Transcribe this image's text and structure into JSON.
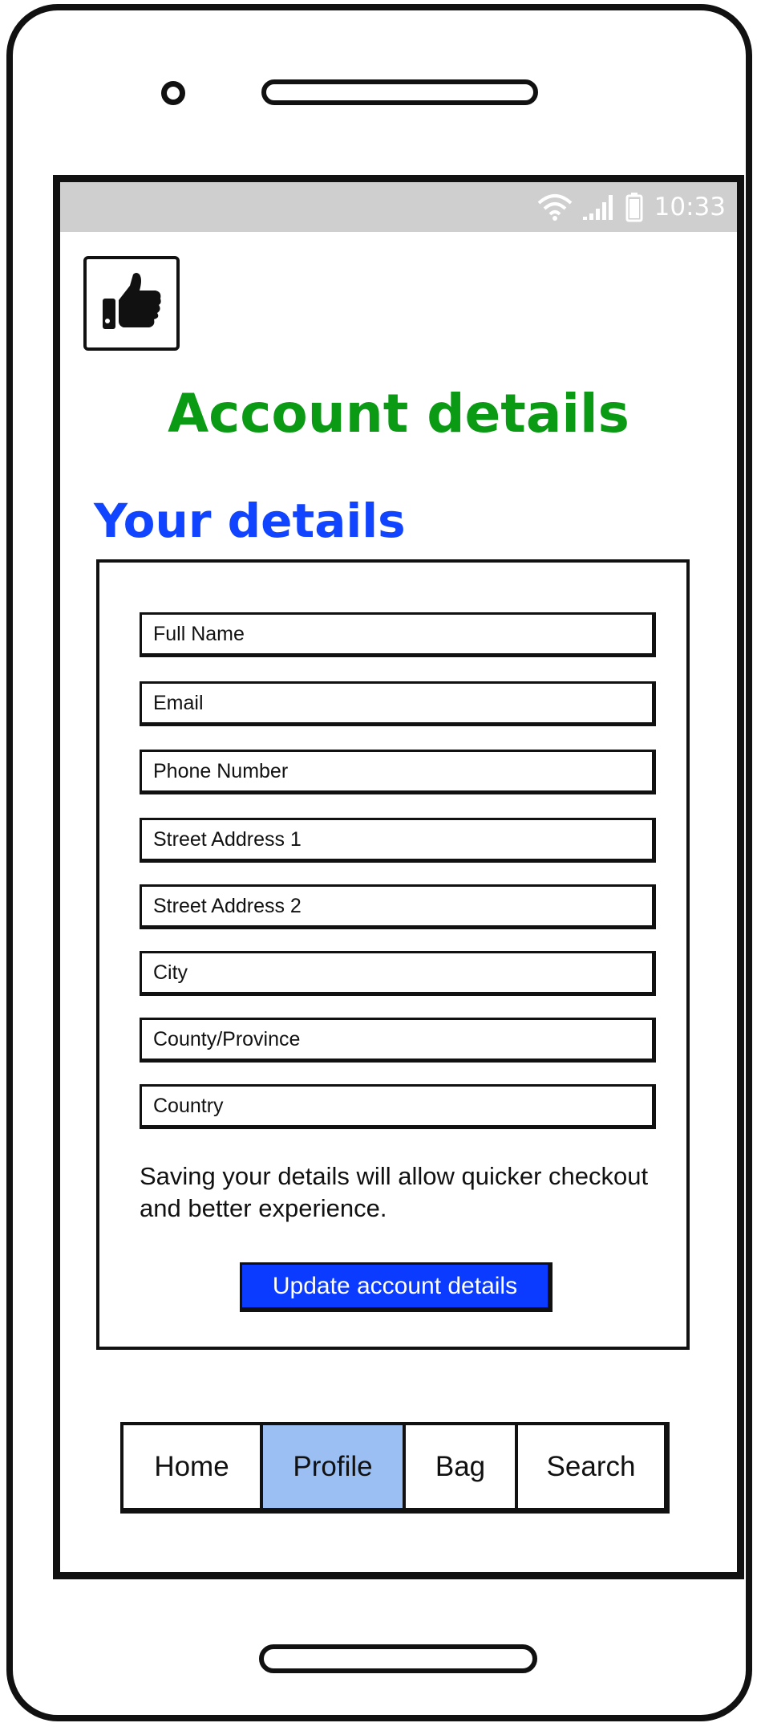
{
  "status_bar": {
    "time": "10:33",
    "icons": [
      "wifi-icon",
      "signal-icon",
      "battery-icon"
    ]
  },
  "logo": {
    "icon": "thumbs-up-icon"
  },
  "page": {
    "title": "Account details",
    "section_title": "Your details"
  },
  "form": {
    "fields": [
      {
        "name": "full-name-field",
        "placeholder": "Full Name"
      },
      {
        "name": "email-field",
        "placeholder": "Email"
      },
      {
        "name": "phone-number-field",
        "placeholder": "Phone Number"
      },
      {
        "name": "street-address-1-field",
        "placeholder": "Street Address 1"
      },
      {
        "name": "street-address-2-field",
        "placeholder": "Street Address 2"
      },
      {
        "name": "city-field",
        "placeholder": "City"
      },
      {
        "name": "county-province-field",
        "placeholder": "County/Province"
      },
      {
        "name": "country-field",
        "placeholder": "Country"
      }
    ],
    "info_text": "Saving your details will allow quicker checkout and better experience.",
    "submit_label": "Update account details"
  },
  "tabs": [
    {
      "label": "Home",
      "active": false
    },
    {
      "label": "Profile",
      "active": true
    },
    {
      "label": "Bag",
      "active": false
    },
    {
      "label": "Search",
      "active": false
    }
  ],
  "colors": {
    "title_green": "#0a9a14",
    "section_blue": "#1144ff",
    "button_blue": "#0a3bff",
    "active_tab": "#9bbff2",
    "status_bar_gray": "#cfcfcf"
  }
}
